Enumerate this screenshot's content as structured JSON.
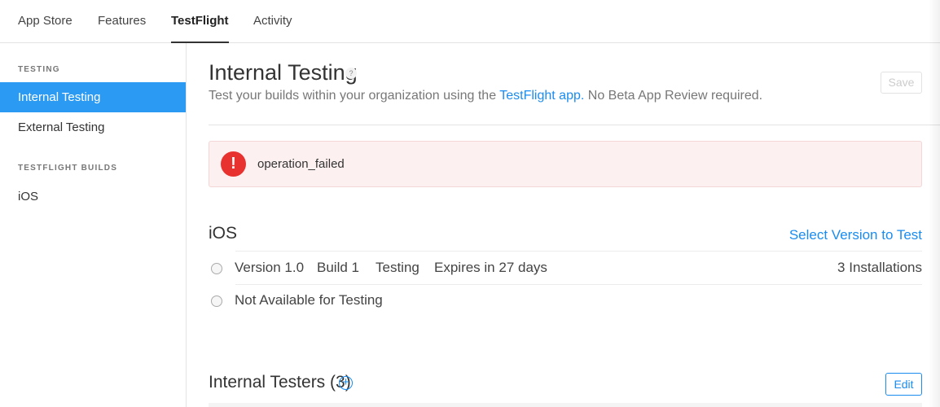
{
  "nav": {
    "tabs": [
      {
        "label": "App Store"
      },
      {
        "label": "Features"
      },
      {
        "label": "TestFlight"
      },
      {
        "label": "Activity"
      }
    ],
    "active": "TestFlight"
  },
  "sidebar": {
    "sections": [
      {
        "heading": "TESTING",
        "items": [
          {
            "label": "Internal Testing"
          },
          {
            "label": "External Testing"
          }
        ]
      },
      {
        "heading": "TESTFLIGHT BUILDS",
        "items": [
          {
            "label": "iOS"
          }
        ]
      }
    ],
    "selected": "Internal Testing"
  },
  "main": {
    "title": "Internal Testing",
    "help_icon": "?",
    "subtitle_pre": "Test your builds within your organization using the ",
    "subtitle_link": "TestFlight app.",
    "subtitle_post": " No Beta App Review required.",
    "save_label": "Save",
    "error": {
      "icon": "!",
      "message": "operation_failed"
    },
    "platform": {
      "title": "iOS",
      "select_link": "Select Version to Test",
      "builds": [
        {
          "version": "Version 1.0",
          "build": "Build 1",
          "status": "Testing",
          "expires": "Expires in 27 days",
          "installs": "3 Installations"
        },
        {
          "label": "Not Available for Testing"
        }
      ]
    },
    "testers": {
      "title": "Internal Testers",
      "count": "(3)",
      "add_icon": "+",
      "edit_label": "Edit"
    }
  },
  "colors": {
    "accent": "#1a8cf0",
    "selected": "#2b9af3",
    "error": "#e8322f",
    "error_bg": "#fdf0f0"
  }
}
